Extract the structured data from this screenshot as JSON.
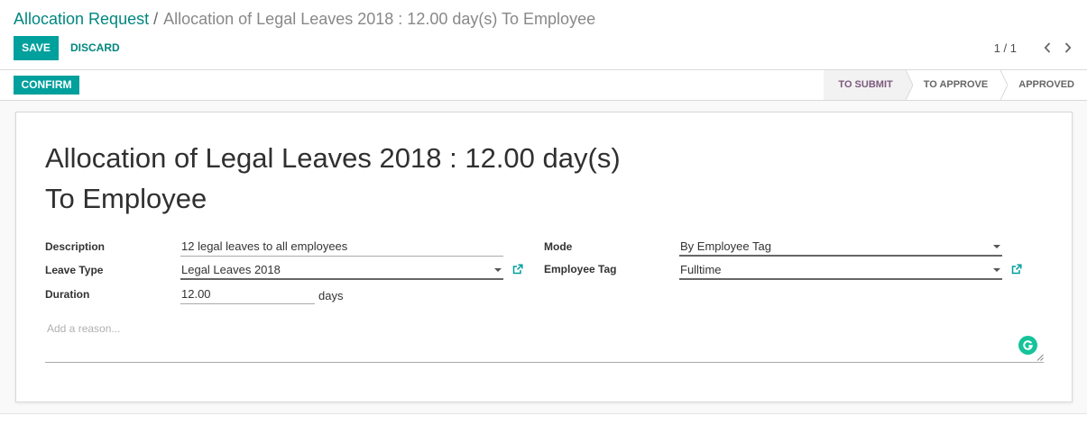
{
  "breadcrumb": {
    "parent": "Allocation Request",
    "separator": "/",
    "current": "Allocation of Legal Leaves 2018 : 12.00 day(s) To Employee"
  },
  "toolbar": {
    "save_label": "SAVE",
    "discard_label": "DISCARD"
  },
  "pager": {
    "value": "1 / 1"
  },
  "statusbar": {
    "confirm_label": "CONFIRM",
    "stages": [
      "TO SUBMIT",
      "TO APPROVE",
      "APPROVED"
    ],
    "current_stage": "TO SUBMIT"
  },
  "form": {
    "title_line1": "Allocation of Legal Leaves 2018 : 12.00 day(s)",
    "title_line2": "To Employee",
    "description_label": "Description",
    "description_value": "12 legal leaves to all employees",
    "leave_type_label": "Leave Type",
    "leave_type_value": "Legal Leaves 2018",
    "duration_label": "Duration",
    "duration_value": "12.00",
    "duration_unit": "days",
    "mode_label": "Mode",
    "mode_value": "By Employee Tag",
    "employee_tag_label": "Employee Tag",
    "employee_tag_value": "Fulltime",
    "reason_placeholder": "Add a reason..."
  },
  "icons": {
    "external_link": "external-link-icon",
    "grammarly": "grammarly-icon",
    "pager_prev": "chevron-left-icon",
    "pager_next": "chevron-right-icon"
  },
  "colors": {
    "primary": "#00a09d",
    "link": "#00877f",
    "current_stage_text": "#7c5a7e",
    "grammarly": "#15c39a"
  }
}
